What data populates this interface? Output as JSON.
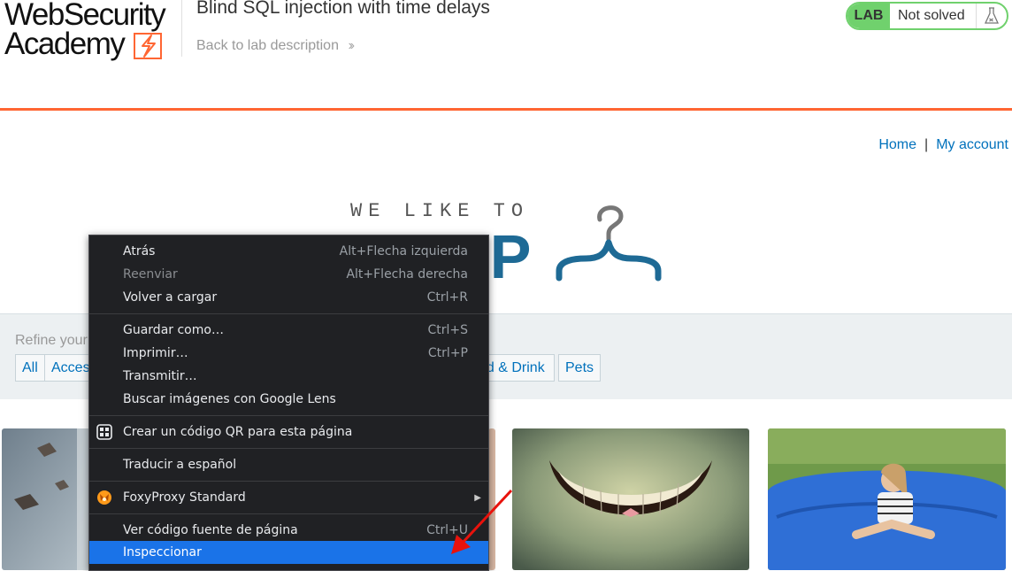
{
  "header": {
    "logo_line1": "WebSecurity",
    "logo_line2": "Academy",
    "lab_title": "Blind SQL injection with time delays",
    "back_link": "Back to lab description",
    "badge_lab": "LAB",
    "badge_status": "Not solved"
  },
  "nav": {
    "home": "Home",
    "separator": "|",
    "account": "My account"
  },
  "shop_logo": {
    "tagline": "WE LIKE TO",
    "word": "SHOP"
  },
  "filter": {
    "label": "Refine your",
    "categories": [
      "All",
      "Access",
      "od & Drink",
      "Pets"
    ]
  },
  "context_menu": {
    "items": [
      {
        "label": "Atrás",
        "shortcut": "Alt+Flecha izquierda"
      },
      {
        "label": "Reenviar",
        "shortcut": "Alt+Flecha derecha",
        "disabled": true
      },
      {
        "label": "Volver a cargar",
        "shortcut": "Ctrl+R"
      },
      {
        "label": "Guardar como…",
        "shortcut": "Ctrl+S"
      },
      {
        "label": "Imprimir…",
        "shortcut": "Ctrl+P"
      },
      {
        "label": "Transmitir…",
        "shortcut": ""
      },
      {
        "label": "Buscar imágenes con Google Lens",
        "shortcut": ""
      },
      {
        "label": "Crear un código QR para esta página",
        "shortcut": "",
        "icon": "qr-code-icon"
      },
      {
        "label": "Traducir a español",
        "shortcut": ""
      },
      {
        "label": "FoxyProxy Standard",
        "shortcut": "",
        "icon": "foxyproxy-icon",
        "submenu": true
      },
      {
        "label": "Ver código fuente de página",
        "shortcut": "Ctrl+U"
      },
      {
        "label": "Inspeccionar",
        "shortcut": "",
        "highlighted": true
      }
    ]
  },
  "colors": {
    "accent_orange": "#ff6633",
    "lab_green": "#70d16d",
    "link_blue": "#0071bc",
    "shop_blue": "#1e6a95",
    "menu_bg": "#202124",
    "menu_highlight": "#1a73e8"
  }
}
